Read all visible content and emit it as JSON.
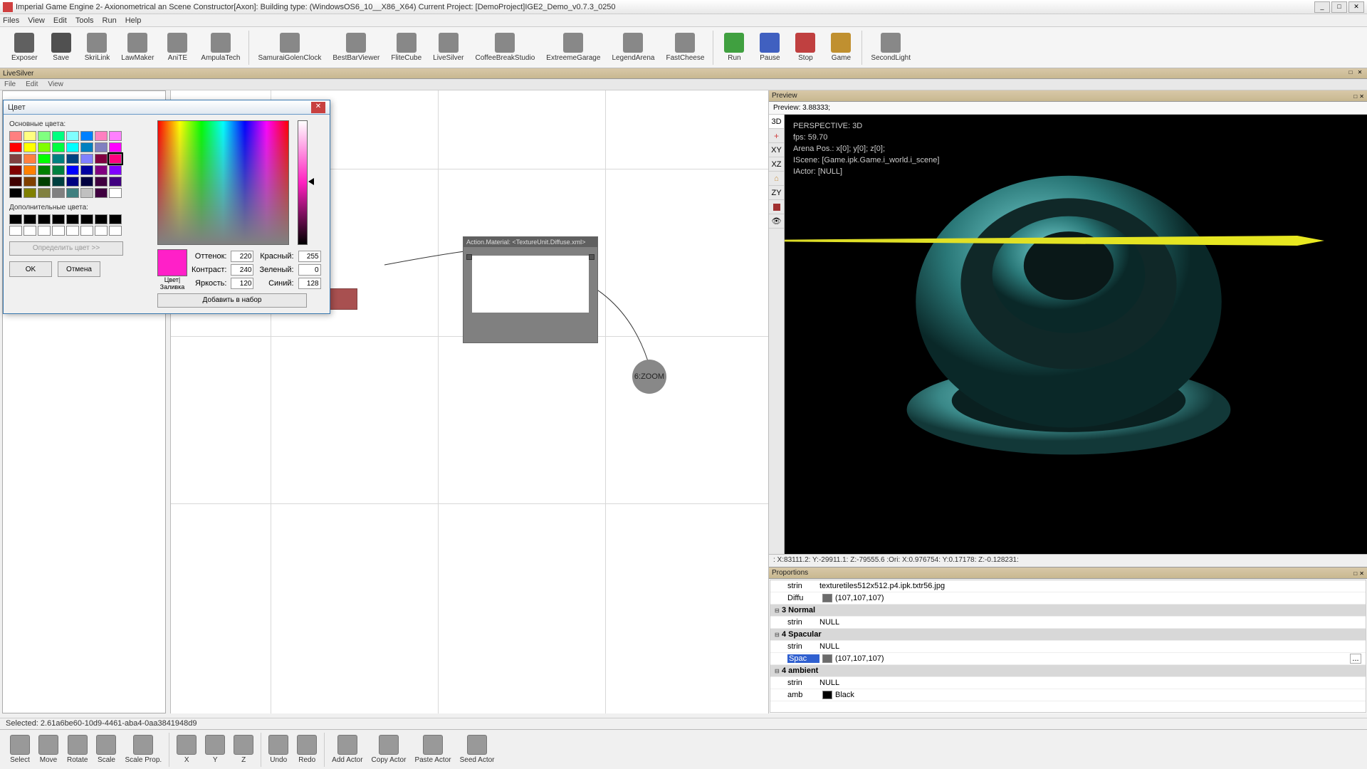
{
  "titlebar": {
    "text": "Imperial Game Engine 2- Axionometrical an Scene Constructor[Axon]: Building type: (WindowsOS6_10__X86_X64) Current Project: [DemoProject]IGE2_Demo_v0.7.3_0250"
  },
  "menubar": {
    "items": [
      "Files",
      "View",
      "Edit",
      "Tools",
      "Run",
      "Help"
    ]
  },
  "toolbar": [
    {
      "label": "Exposer"
    },
    {
      "label": "Save"
    },
    {
      "label": "SkriLink"
    },
    {
      "label": "LawMaker"
    },
    {
      "label": "AniTE"
    },
    {
      "label": "AmpulaTech"
    },
    {
      "sep": true
    },
    {
      "label": "SamuraiGolenClock"
    },
    {
      "label": "BestBarViewer"
    },
    {
      "label": "FliteCube"
    },
    {
      "label": "LiveSilver"
    },
    {
      "label": "CoffeeBreakStudio"
    },
    {
      "label": "ExtreemeGarage"
    },
    {
      "label": "LegendArena"
    },
    {
      "label": "FastCheese"
    },
    {
      "sep": true
    },
    {
      "label": "Run"
    },
    {
      "label": "Pause"
    },
    {
      "label": "Stop"
    },
    {
      "label": "Game"
    },
    {
      "sep": true
    },
    {
      "label": "SecondLight"
    }
  ],
  "sub_header": {
    "title": "LiveSilver"
  },
  "sub_menubar": {
    "items": [
      "File",
      "Edit",
      "View"
    ]
  },
  "canvas": {
    "node_header": "Action.Material: <TextureUnit.Diffuse.xml>",
    "circle_label": "6:ZOOM"
  },
  "preview": {
    "title": "Preview",
    "sub": "Preview: 3.88333;",
    "tabs": [
      "3D",
      "XY",
      "XZ",
      "ZY"
    ],
    "overlay": {
      "l1": "PERSPECTIVE: 3D",
      "l2": "fps: 59.70",
      "l3": "Arena Pos.: x[0]; y[0]; z[0];",
      "l4": "IScene: [Game.ipk.Game.i_world.i_scene]",
      "l5": "IActor: [NULL]"
    },
    "status": ":  X:83111.2: Y:-29911.1: Z:-79555.6 :Ori: X:0.976754: Y:0.17178: Z:-0.128231:"
  },
  "proportions": {
    "title": "Proportions",
    "rows": [
      {
        "type": "val",
        "label": "strin",
        "value": "texturetiles512x512.p4.ipk.txtr56.jpg"
      },
      {
        "type": "color",
        "label": "Diffu",
        "swatch": "#6b6b6b",
        "value": "(107,107,107)"
      },
      {
        "type": "group",
        "value": "3 Normal"
      },
      {
        "type": "val",
        "label": "strin",
        "value": "NULL"
      },
      {
        "type": "group",
        "value": "4 Spacular"
      },
      {
        "type": "val",
        "label": "strin",
        "value": "NULL"
      },
      {
        "type": "color-sel",
        "label": "Spac",
        "swatch": "#6b6b6b",
        "value": "(107,107,107)"
      },
      {
        "type": "group",
        "value": "4 ambient"
      },
      {
        "type": "val",
        "label": "strin",
        "value": "NULL"
      },
      {
        "type": "color",
        "label": "amb",
        "swatch": "#000000",
        "value": "Black"
      }
    ]
  },
  "statusbar": {
    "text": "Selected:    2.61a6be60-10d9-4461-aba4-0aa3841948d9"
  },
  "bottom_tools": [
    {
      "label": "Select"
    },
    {
      "label": "Move"
    },
    {
      "label": "Rotate"
    },
    {
      "label": "Scale"
    },
    {
      "label": "Scale Prop."
    },
    {
      "sep": true
    },
    {
      "label": "X"
    },
    {
      "label": "Y"
    },
    {
      "label": "Z"
    },
    {
      "sep": true
    },
    {
      "label": "Undo"
    },
    {
      "label": "Redo"
    },
    {
      "sep": true
    },
    {
      "label": "Add Actor"
    },
    {
      "label": "Copy Actor"
    },
    {
      "label": "Paste Actor"
    },
    {
      "label": "Seed Actor"
    }
  ],
  "color_dialog": {
    "title": "Цвет",
    "basic_label": "Основные цвета:",
    "custom_label": "Дополнительные цвета:",
    "define_btn": "Определить цвет >>",
    "ok": "OK",
    "cancel": "Отмена",
    "preview_label": "Цвет|Заливка",
    "add_btn": "Добавить в набор",
    "fields": {
      "hue_l": "Оттенок:",
      "hue_v": "220",
      "sat_l": "Контраст:",
      "sat_v": "240",
      "lum_l": "Яркость:",
      "lum_v": "120",
      "r_l": "Красный:",
      "r_v": "255",
      "g_l": "Зеленый:",
      "g_v": "0",
      "b_l": "Синий:",
      "b_v": "128"
    },
    "basic_colors": [
      "#ff8080",
      "#ffff80",
      "#80ff80",
      "#00ff80",
      "#80ffff",
      "#0080ff",
      "#ff80c0",
      "#ff80ff",
      "#ff0000",
      "#ffff00",
      "#80ff00",
      "#00ff40",
      "#00ffff",
      "#0080c0",
      "#8080c0",
      "#ff00ff",
      "#804040",
      "#ff8040",
      "#00ff00",
      "#008080",
      "#004080",
      "#8080ff",
      "#800040",
      "#ff0080",
      "#800000",
      "#ff8000",
      "#008000",
      "#008040",
      "#0000ff",
      "#0000a0",
      "#800080",
      "#8000ff",
      "#400000",
      "#804000",
      "#004000",
      "#004040",
      "#000080",
      "#000040",
      "#400040",
      "#400080",
      "#000000",
      "#808000",
      "#808040",
      "#808080",
      "#408080",
      "#c0c0c0",
      "#400040",
      "#ffffff"
    ],
    "custom_colors": [
      "#000000",
      "#000000",
      "#000000",
      "#000000",
      "#000000",
      "#000000",
      "#000000",
      "#000000",
      "#ffffff",
      "#ffffff",
      "#ffffff",
      "#ffffff",
      "#ffffff",
      "#ffffff",
      "#ffffff",
      "#ffffff"
    ]
  }
}
